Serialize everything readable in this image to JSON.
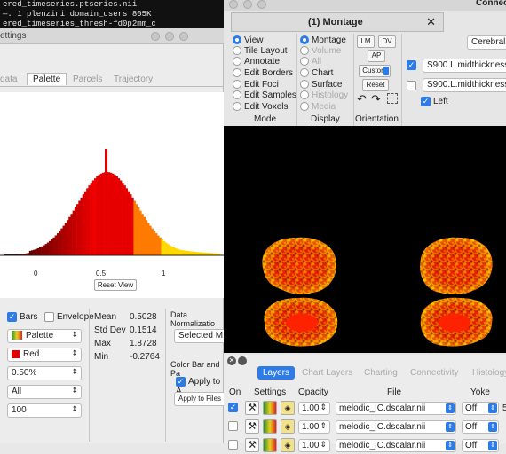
{
  "terminal": {
    "lines": [
      "                     ",
      "ered_timeseries.ptseries.nii",
      "—. 1 plenzini domain_users 805K",
      "ered_timeseries_thresh-fd0p2mm_c"
    ]
  },
  "settings": {
    "title": "ettings",
    "tabs": [
      "data",
      "Palette",
      "Parcels",
      "Trajectory"
    ],
    "active_tab": "Palette",
    "histogram": {
      "x_ticks": [
        "0",
        "0.5",
        "1"
      ],
      "reset_view": "Reset View"
    },
    "options": {
      "bars_label": "Bars",
      "envelope_label": "Envelope",
      "palette_label": "Palette",
      "color_label": "Red",
      "percent_value": "0.50%",
      "all_value": "All",
      "bins_value": "100"
    },
    "stats": {
      "mean_label": "Mean",
      "mean_value": "0.5028",
      "std_label": "Std Dev",
      "std_value": "0.1514",
      "max_label": "Max",
      "max_value": "1.8728",
      "min_label": "Min",
      "min_value": "-0.2764"
    },
    "data_norm": {
      "label": "Data Normalizatio",
      "selected": "Selected M"
    },
    "colorbar": {
      "label": "Color Bar and Pa",
      "apply_all": "Apply to A",
      "apply_files": "Apply to Files"
    }
  },
  "montage": {
    "window_title": "Connect",
    "tab_title": "(1) Montage",
    "close_glyph": "✕",
    "mode": {
      "header": "Mode",
      "items": [
        "View",
        "Tile Layout",
        "Annotate",
        "Edit Borders",
        "Edit Foci",
        "Edit Samples",
        "Edit Voxels"
      ],
      "selected": "View"
    },
    "display": {
      "header": "Display",
      "items": [
        "Montage",
        "Volume",
        "All",
        "Chart",
        "Surface",
        "Histology",
        "Media"
      ],
      "enabled": [
        true,
        false,
        false,
        true,
        true,
        false,
        false
      ],
      "selected": "Montage"
    },
    "orientation": {
      "header": "Orientation",
      "lm": "LM",
      "dv": "DV",
      "ap": "AP",
      "custom": "Custom",
      "reset": "Reset"
    },
    "right_panel": {
      "dropdown": "Cerebral",
      "surface1": "S900.L.midthickness_",
      "surface1_checked": true,
      "surface2": "S900.L.midthickness_",
      "surface2_checked": false,
      "left_label": "Left",
      "left_checked": true
    },
    "layers_panel": {
      "tabs": [
        "Layers",
        "Chart Layers",
        "Charting",
        "Connectivity",
        "Histology"
      ],
      "active_tab": "Layers",
      "headers": {
        "on": "On",
        "settings": "Settings",
        "opacity": "Opacity",
        "file": "File",
        "yoke": "Yoke"
      },
      "rows": [
        {
          "on": true,
          "opacity": "1.00",
          "file": "melodic_IC.dscalar.nii",
          "yoke": "Off",
          "extra": "5"
        },
        {
          "on": false,
          "opacity": "1.00",
          "file": "melodic_IC.dscalar.nii",
          "yoke": "Off",
          "extra": ""
        },
        {
          "on": false,
          "opacity": "1.00",
          "file": "melodic_IC.dscalar.nii",
          "yoke": "Off",
          "extra": ""
        }
      ]
    }
  },
  "colors": {
    "accent": "#2f7be5",
    "histogram_peak": "#e60000",
    "brain_base": "#c81800"
  }
}
